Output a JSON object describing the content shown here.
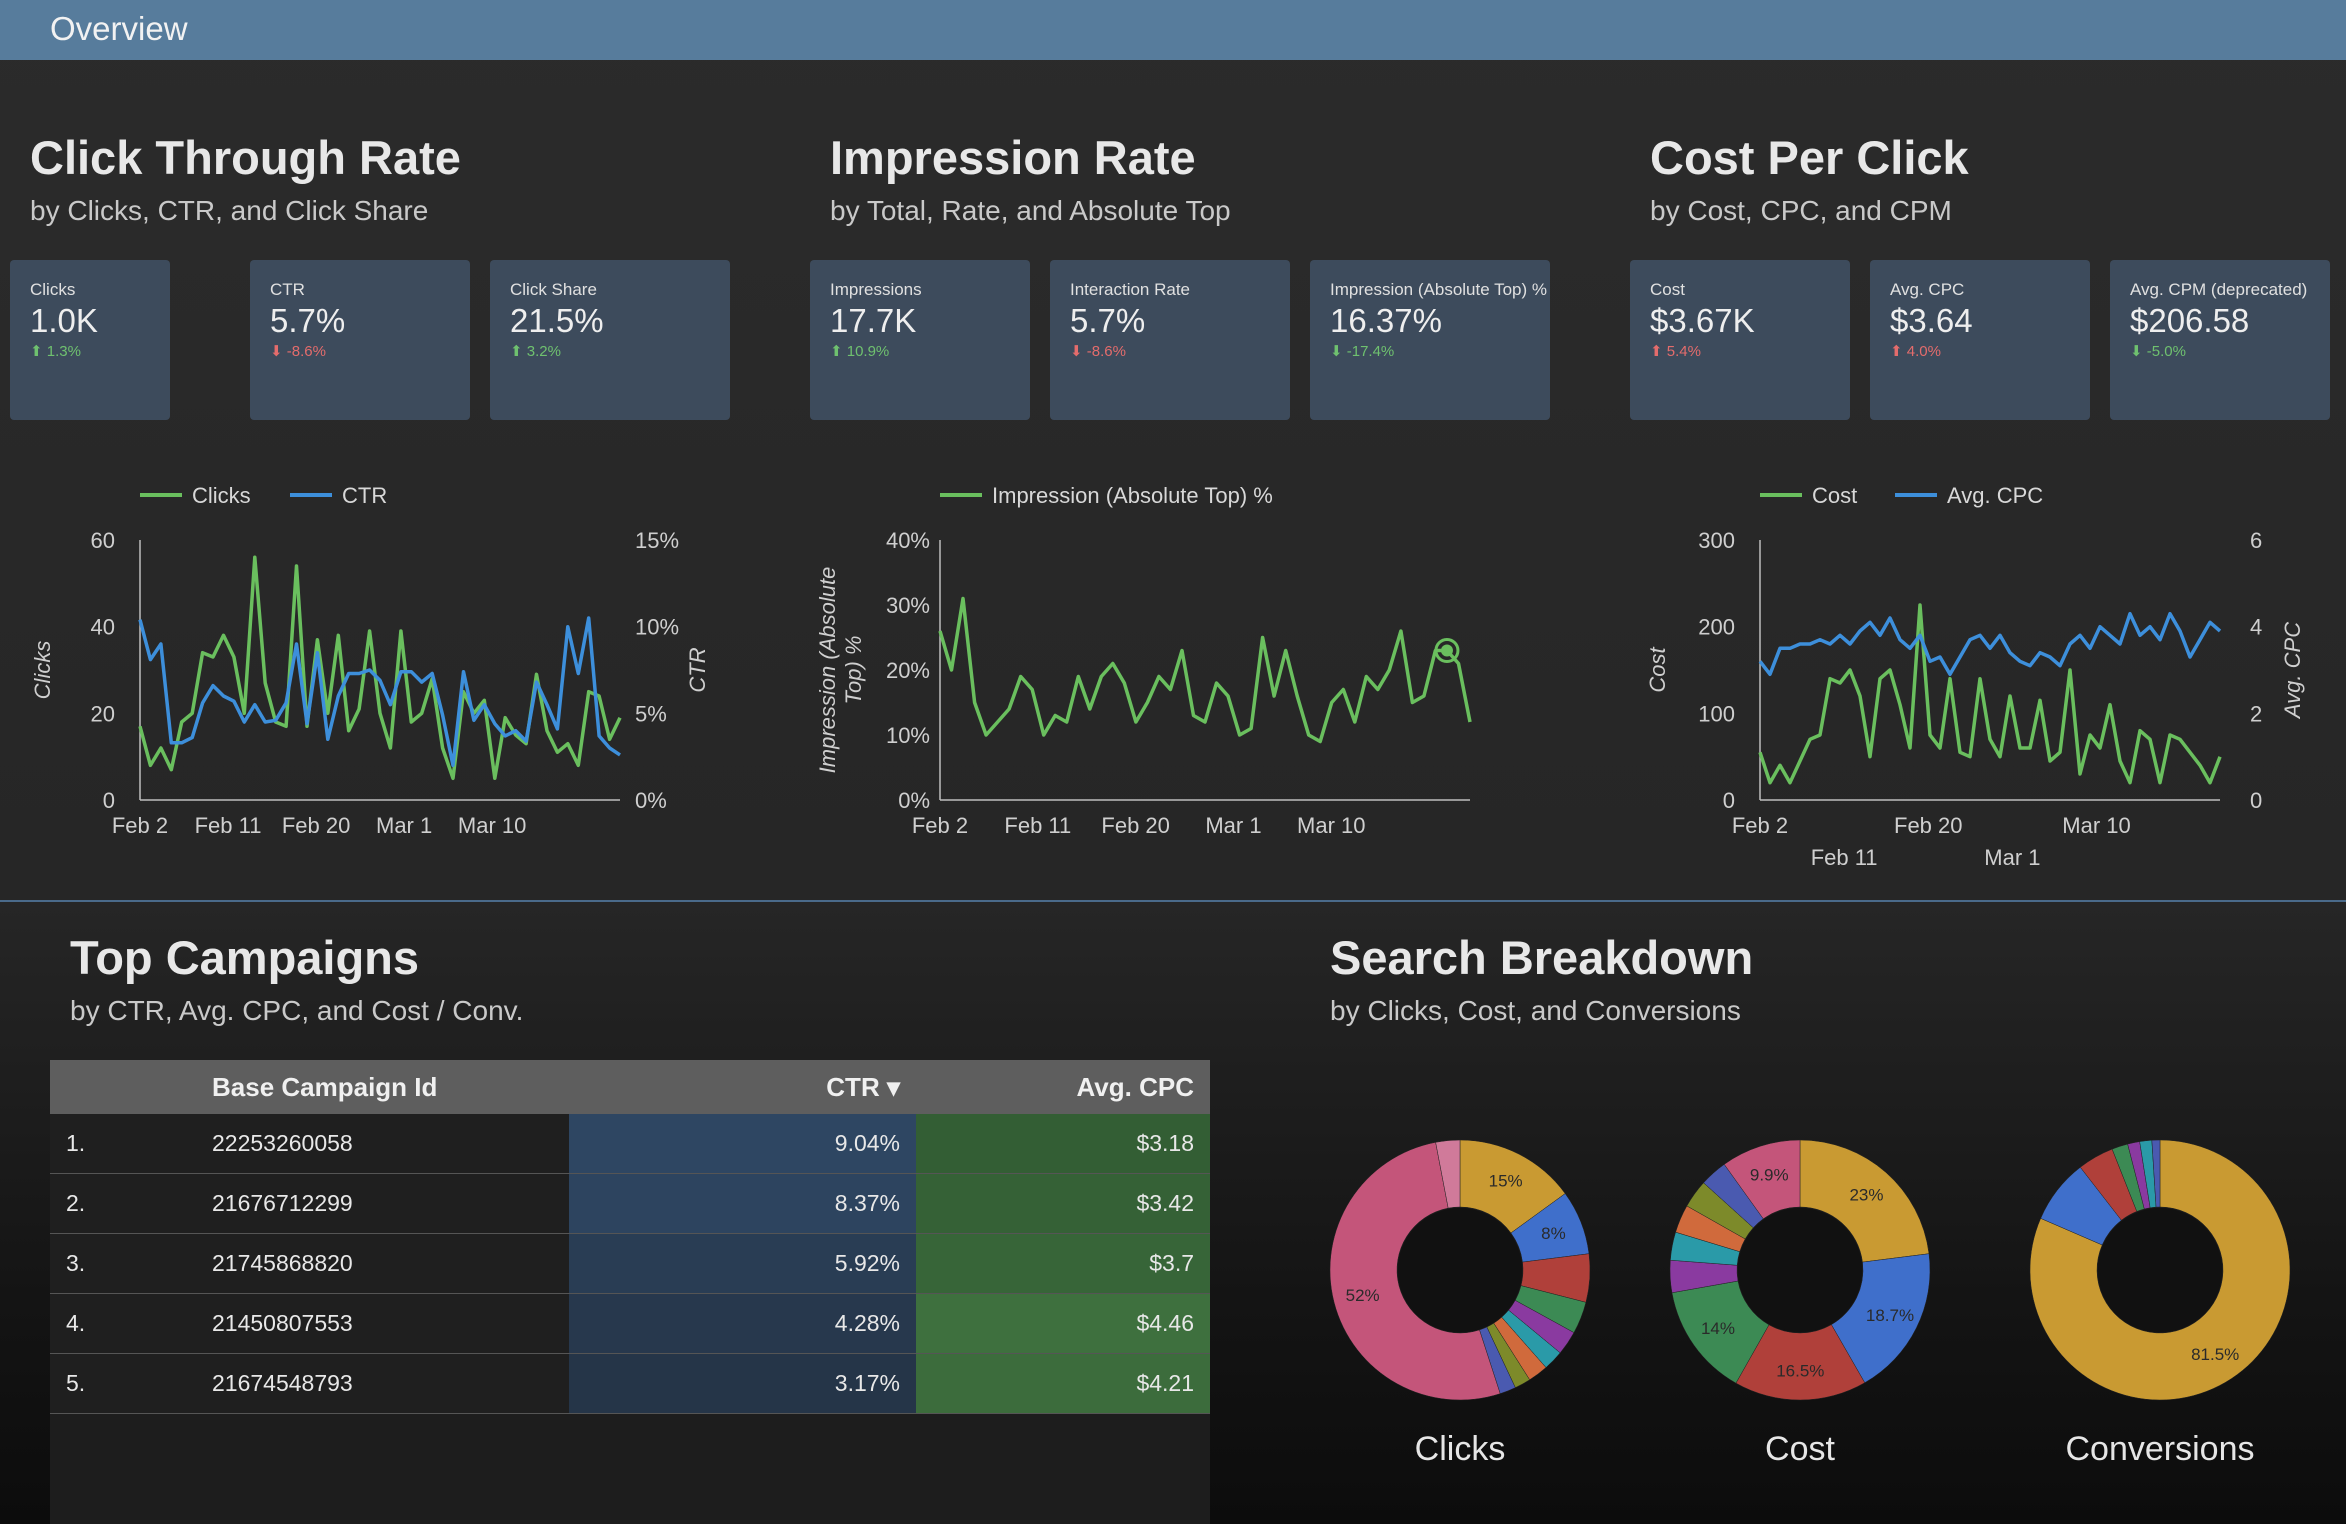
{
  "header": {
    "title": "Overview"
  },
  "sections": {
    "ctr": {
      "title": "Click Through Rate",
      "subtitle": "by Clicks, CTR, and Click Share"
    },
    "impr": {
      "title": "Impression Rate",
      "subtitle": "by Total, Rate, and Absolute Top"
    },
    "cpc": {
      "title": "Cost Per Click",
      "subtitle": "by Cost, CPC, and CPM"
    },
    "campaigns": {
      "title": "Top Campaigns",
      "subtitle": "by CTR, Avg. CPC, and Cost / Conv."
    },
    "search": {
      "title": "Search Breakdown",
      "subtitle": "by Clicks, Cost, and Conversions"
    }
  },
  "kpis": [
    {
      "label": "Clicks",
      "value": "1.0K",
      "delta": "⬆ 1.3%",
      "color": "#6fc16f"
    },
    {
      "label": "CTR",
      "value": "5.7%",
      "delta": "⬇ -8.6%",
      "color": "#e46c6c"
    },
    {
      "label": "Click Share",
      "value": "21.5%",
      "delta": "⬆ 3.2%",
      "color": "#6fc16f"
    },
    {
      "label": "Impressions",
      "value": "17.7K",
      "delta": "⬆ 10.9%",
      "color": "#6fc16f"
    },
    {
      "label": "Interaction Rate",
      "value": "5.7%",
      "delta": "⬇ -8.6%",
      "color": "#e46c6c"
    },
    {
      "label": "Impression (Absolute Top) %",
      "value": "16.37%",
      "delta": "⬇ -17.4%",
      "color": "#6fc16f"
    },
    {
      "label": "Cost",
      "value": "$3.67K",
      "delta": "⬆ 5.4%",
      "color": "#e46c6c"
    },
    {
      "label": "Avg. CPC",
      "value": "$3.64",
      "delta": "⬆ 4.0%",
      "color": "#e46c6c"
    },
    {
      "label": "Avg. CPM (deprecated)",
      "value": "$206.58",
      "delta": "⬇ -5.0%",
      "color": "#6fc16f"
    }
  ],
  "colors": {
    "green": "#6abf5e",
    "blue": "#3d8fdb",
    "text": "#dcdcdc",
    "axis": "#cfcfcf"
  },
  "chart_data": [
    {
      "type": "line",
      "x_tick_labels": [
        "Feb 2",
        "Feb 11",
        "Feb 20",
        "Mar 1",
        "Mar 10"
      ],
      "ylabel": "Clicks",
      "ylabel_right": "CTR",
      "ylim": [
        0,
        60
      ],
      "ylim_right": [
        0,
        15
      ],
      "yticks": [
        "0",
        "20",
        "40",
        "60"
      ],
      "yticks_right": [
        "0%",
        "5%",
        "10%",
        "15%"
      ],
      "legend_position": "top",
      "series": [
        {
          "name": "Clicks",
          "axis": "left",
          "color": "#6abf5e",
          "values": [
            17,
            8,
            12,
            7,
            18,
            20,
            34,
            33,
            38,
            33,
            20,
            56,
            27,
            18,
            17,
            54,
            17,
            37,
            20,
            38,
            16,
            21,
            39,
            20,
            12,
            39,
            18,
            20,
            28,
            12,
            5,
            25,
            20,
            23,
            5,
            19,
            15,
            13,
            29,
            16,
            11,
            13,
            8,
            25,
            24,
            14,
            19
          ]
        },
        {
          "name": "CTR",
          "axis": "right",
          "color": "#3d8fdb",
          "values": [
            10.4,
            8.1,
            9.0,
            3.3,
            3.3,
            3.6,
            5.6,
            6.6,
            6.0,
            5.7,
            4.5,
            5.5,
            4.5,
            4.6,
            5.6,
            9.0,
            4.4,
            8.5,
            3.5,
            6.0,
            7.3,
            7.3,
            7.5,
            6.9,
            5.5,
            7.4,
            7.4,
            6.8,
            7.3,
            4.9,
            2.0,
            7.4,
            4.6,
            5.5,
            4.4,
            3.7,
            4.0,
            3.4,
            6.8,
            5.5,
            4.1,
            10.0,
            7.3,
            10.5,
            3.7,
            3.0,
            2.6
          ]
        }
      ]
    },
    {
      "type": "line",
      "x_tick_labels": [
        "Feb 2",
        "Feb 11",
        "Feb 20",
        "Mar 1",
        "Mar 10"
      ],
      "ylabel": "Impression (Absolute Top) %",
      "ylim": [
        0,
        40
      ],
      "yticks": [
        "0%",
        "10%",
        "20%",
        "30%",
        "40%"
      ],
      "legend_position": "top",
      "series": [
        {
          "name": "Impression (Absolute Top) %",
          "color": "#6abf5e",
          "values": [
            26,
            20,
            31,
            15,
            10,
            12,
            14,
            19,
            17,
            10,
            13,
            12,
            19,
            14,
            19,
            21,
            18,
            12,
            15,
            19,
            17,
            23,
            13,
            12,
            18,
            16,
            10,
            11,
            25,
            16,
            23,
            16,
            10,
            9,
            15,
            17,
            12,
            19,
            17,
            20,
            26,
            15,
            16,
            23,
            23,
            21,
            12
          ]
        }
      ]
    },
    {
      "type": "line",
      "x_tick_labels": [
        "Feb 2",
        "Feb 11",
        "Feb 20",
        "Mar 1",
        "Mar 10"
      ],
      "ylabel": "Cost",
      "ylabel_right": "Avg. CPC",
      "ylim": [
        0,
        300
      ],
      "ylim_right": [
        0,
        6
      ],
      "yticks": [
        "0",
        "100",
        "200",
        "300"
      ],
      "yticks_right": [
        "0",
        "2",
        "4",
        "6"
      ],
      "legend_position": "top",
      "series": [
        {
          "name": "Cost",
          "axis": "left",
          "color": "#6abf5e",
          "values": [
            55,
            20,
            40,
            20,
            45,
            70,
            75,
            140,
            135,
            150,
            120,
            50,
            140,
            150,
            110,
            60,
            225,
            75,
            60,
            140,
            55,
            50,
            140,
            70,
            50,
            120,
            60,
            60,
            115,
            45,
            55,
            150,
            30,
            75,
            60,
            110,
            45,
            20,
            80,
            70,
            20,
            75,
            70,
            55,
            40,
            20,
            50
          ]
        },
        {
          "name": "Avg. CPC",
          "axis": "right",
          "color": "#3d8fdb",
          "values": [
            3.2,
            2.9,
            3.5,
            3.5,
            3.6,
            3.6,
            3.7,
            3.6,
            3.8,
            3.6,
            3.9,
            4.1,
            3.8,
            4.2,
            3.7,
            3.5,
            3.8,
            3.2,
            3.3,
            2.9,
            3.3,
            3.7,
            3.8,
            3.5,
            3.8,
            3.4,
            3.2,
            3.1,
            3.4,
            3.3,
            3.1,
            3.6,
            3.8,
            3.5,
            4.0,
            3.8,
            3.6,
            4.3,
            3.8,
            4.0,
            3.7,
            4.3,
            3.9,
            3.3,
            3.7,
            4.1,
            3.9
          ]
        }
      ]
    },
    {
      "type": "table",
      "columns": [
        "",
        "Base Campaign Id",
        "CTR ▾",
        "Avg. CPC"
      ],
      "rows": [
        [
          "1.",
          "22253260058",
          "9.04%",
          "$3.18"
        ],
        [
          "2.",
          "21676712299",
          "8.37%",
          "$3.42"
        ],
        [
          "3.",
          "21745868820",
          "5.92%",
          "$3.7"
        ],
        [
          "4.",
          "21450807553",
          "4.28%",
          "$4.46"
        ],
        [
          "5.",
          "21674548793",
          "3.17%",
          "$4.21"
        ]
      ],
      "ctr_values": [
        9.04,
        8.37,
        5.92,
        4.28,
        3.17
      ],
      "cpc_values": [
        3.18,
        3.42,
        3.7,
        4.46,
        4.21
      ]
    },
    {
      "type": "pie",
      "title": "Clicks",
      "slices": [
        {
          "value": 15,
          "color": "#c99a32",
          "label": "15%"
        },
        {
          "value": 8,
          "color": "#3f6fcb",
          "label": "8%"
        },
        {
          "value": 6,
          "color": "#b0403a",
          "label": ""
        },
        {
          "value": 4,
          "color": "#3c8a54",
          "label": ""
        },
        {
          "value": 3,
          "color": "#8a3aa0",
          "label": ""
        },
        {
          "value": 2.5,
          "color": "#2a9aa8",
          "label": ""
        },
        {
          "value": 2.5,
          "color": "#d06a3c",
          "label": ""
        },
        {
          "value": 2,
          "color": "#7d8a2a",
          "label": ""
        },
        {
          "value": 2,
          "color": "#4a5ab0",
          "label": ""
        },
        {
          "value": 52,
          "color": "#c4557a",
          "label": "52%"
        },
        {
          "value": 3,
          "color": "#d07a9a",
          "label": ""
        }
      ]
    },
    {
      "type": "pie",
      "title": "Cost",
      "slices": [
        {
          "value": 23,
          "color": "#c99a32",
          "label": "23%"
        },
        {
          "value": 18.7,
          "color": "#3f6fcb",
          "label": "18.7%"
        },
        {
          "value": 16.5,
          "color": "#b0403a",
          "label": "16.5%"
        },
        {
          "value": 14,
          "color": "#3c8a54",
          "label": "14%"
        },
        {
          "value": 4,
          "color": "#8a3aa0",
          "label": ""
        },
        {
          "value": 3.5,
          "color": "#2a9aa8",
          "label": ""
        },
        {
          "value": 3.5,
          "color": "#d06a3c",
          "label": ""
        },
        {
          "value": 3.5,
          "color": "#7d8a2a",
          "label": ""
        },
        {
          "value": 3.4,
          "color": "#4a5ab0",
          "label": ""
        },
        {
          "value": 9.9,
          "color": "#c4557a",
          "label": "9.9%"
        }
      ]
    },
    {
      "type": "pie",
      "title": "Conversions",
      "slices": [
        {
          "value": 81.5,
          "color": "#c99a32",
          "label": "81.5%"
        },
        {
          "value": 8,
          "color": "#3f6fcb",
          "label": ""
        },
        {
          "value": 4.5,
          "color": "#b0403a",
          "label": ""
        },
        {
          "value": 2,
          "color": "#3c8a54",
          "label": ""
        },
        {
          "value": 1.5,
          "color": "#8a3aa0",
          "label": ""
        },
        {
          "value": 1.5,
          "color": "#2a9aa8",
          "label": ""
        },
        {
          "value": 1,
          "color": "#4a5ab0",
          "label": ""
        }
      ]
    }
  ]
}
